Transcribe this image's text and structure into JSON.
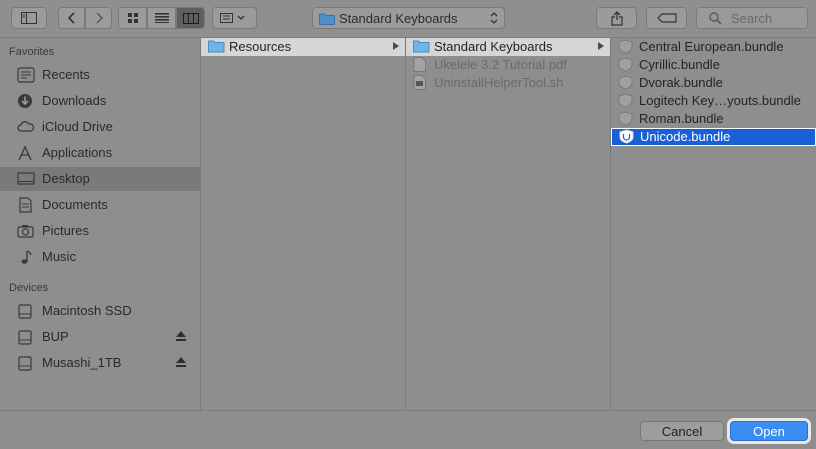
{
  "toolbar": {
    "path_title": "Standard Keyboards",
    "search_placeholder": "Search"
  },
  "sidebar": {
    "favorites_title": "Favorites",
    "favorites": [
      {
        "label": "Recents",
        "icon": "clock-icon"
      },
      {
        "label": "Downloads",
        "icon": "download-icon"
      },
      {
        "label": "iCloud Drive",
        "icon": "cloud-icon"
      },
      {
        "label": "Applications",
        "icon": "applications-icon"
      },
      {
        "label": "Desktop",
        "icon": "desktop-icon",
        "selected": true
      },
      {
        "label": "Documents",
        "icon": "document-icon"
      },
      {
        "label": "Pictures",
        "icon": "camera-icon"
      },
      {
        "label": "Music",
        "icon": "music-note-icon"
      }
    ],
    "devices_title": "Devices",
    "devices": [
      {
        "label": "Macintosh SSD",
        "icon": "drive-icon"
      },
      {
        "label": "BUP",
        "icon": "drive-icon",
        "eject": true
      },
      {
        "label": "Musashi_1TB",
        "icon": "drive-icon",
        "eject": true
      }
    ]
  },
  "columns": [
    {
      "items": [
        {
          "label": "Resources",
          "type": "folder",
          "state": "path",
          "has_children": true
        }
      ]
    },
    {
      "items": [
        {
          "label": "Standard Keyboards",
          "type": "folder",
          "state": "path",
          "has_children": true
        },
        {
          "label": "Ukelele 3.2 Tutorial.pdf",
          "type": "pdf",
          "state": "dim"
        },
        {
          "label": "UninstallHelperTool.sh",
          "type": "script",
          "state": "dim"
        }
      ]
    },
    {
      "items": [
        {
          "label": "Central European.bundle",
          "type": "bundle",
          "state": "normal"
        },
        {
          "label": "Cyrillic.bundle",
          "type": "bundle",
          "state": "normal"
        },
        {
          "label": "Dvorak.bundle",
          "type": "bundle",
          "state": "normal"
        },
        {
          "label": "Logitech Key…youts.bundle",
          "type": "bundle",
          "state": "normal"
        },
        {
          "label": "Roman.bundle",
          "type": "bundle",
          "state": "normal"
        },
        {
          "label": "Unicode.bundle",
          "type": "bundle",
          "state": "active"
        }
      ]
    }
  ],
  "buttons": {
    "cancel": "Cancel",
    "open": "Open"
  },
  "colors": {
    "selection": "#1a5fd6",
    "primary_button": "#3b8cf3",
    "folder": "#6fb6e8"
  }
}
